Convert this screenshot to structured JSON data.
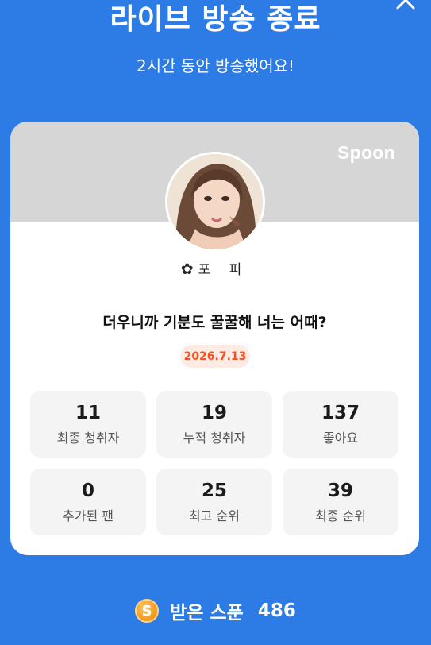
{
  "header": {
    "title": "라이브 방송 종료",
    "subtitle": "2시간 동안 방송했어요!"
  },
  "card": {
    "brand": "Spoon",
    "nickname": "포 피",
    "nickname_decoration": "✿",
    "broadcast_title": "더우니까 기분도 꿀꿀해 너는 어때?",
    "date": "2026.7.13",
    "stats": [
      {
        "value": "11",
        "label": "최종 청취자"
      },
      {
        "value": "19",
        "label": "누적 청취자"
      },
      {
        "value": "137",
        "label": "좋아요"
      },
      {
        "value": "0",
        "label": "추가된 팬"
      },
      {
        "value": "25",
        "label": "최고 순위"
      },
      {
        "value": "39",
        "label": "최종 순위"
      }
    ]
  },
  "footer": {
    "coin_symbol": "S",
    "spoon_label": "받은 스푼",
    "spoon_value": "486"
  },
  "colors": {
    "background": "#2d7be5",
    "banner": "#d6d6d6",
    "date_badge_bg": "#fdebe4",
    "date_badge_text": "#ff4d1f",
    "coin": "#f39a1e"
  }
}
